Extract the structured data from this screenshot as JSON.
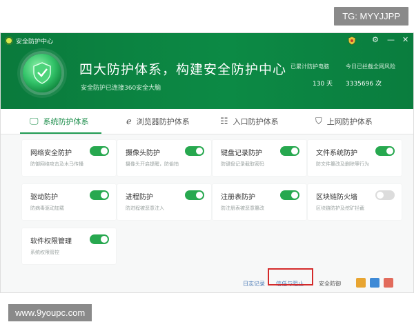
{
  "watermarks": {
    "top": "TG: MYYJJPP",
    "bottom": "www.9youpc.com"
  },
  "window": {
    "title": "安全防护中心",
    "controls": [
      "shield-icon",
      "gear-icon",
      "minimize-icon",
      "close-icon"
    ]
  },
  "header": {
    "slogan": "四大防护体系，构建安全防护中心",
    "subline": "安全防护已连接360安全大脑",
    "stats": [
      {
        "label": "已累计防护电脑",
        "value": "130 天"
      },
      {
        "label": "今日已拦截全网风险",
        "value": "3335696 次"
      }
    ]
  },
  "tabs": [
    {
      "label": "系统防护体系",
      "icon": "monitor-icon",
      "active": true
    },
    {
      "label": "浏览器防护体系",
      "icon": "browser-icon",
      "active": false
    },
    {
      "label": "入口防护体系",
      "icon": "entry-icon",
      "active": false
    },
    {
      "label": "上网防护体系",
      "icon": "shield-icon",
      "active": false
    }
  ],
  "cards": [
    {
      "name": "网络安全防护",
      "desc": "防御网络攻击及木马传播",
      "enabled": true
    },
    {
      "name": "摄像头防护",
      "desc": "摄像头开启提醒，防偷拍",
      "enabled": true
    },
    {
      "name": "键盘记录防护",
      "desc": "防键盘记录截取密码",
      "enabled": true
    },
    {
      "name": "文件系统防护",
      "desc": "防文件篡改及删除等行为",
      "enabled": true
    },
    {
      "name": "驱动防护",
      "desc": "防病毒驱动加载",
      "enabled": true
    },
    {
      "name": "进程防护",
      "desc": "防进程被恶意注入",
      "enabled": true
    },
    {
      "name": "注册表防护",
      "desc": "防注册表被恶意篡改",
      "enabled": true
    },
    {
      "name": "区块链防火墙",
      "desc": "区块链防护及挖矿拦截",
      "enabled": false
    },
    {
      "name": "软件权限管理",
      "desc": "系统权限管控",
      "enabled": true
    }
  ],
  "footer": {
    "links": [
      "日志记录",
      "信任与阻止",
      "安全防御"
    ],
    "accent_colors": {
      "highlight": "#d42a2a",
      "green": "#27a84f"
    }
  }
}
